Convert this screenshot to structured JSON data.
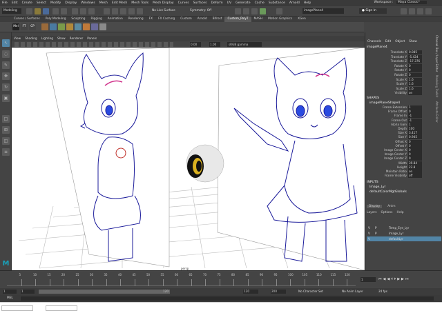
{
  "menubar": {
    "items": [
      "File",
      "Edit",
      "Create",
      "Select",
      "Modify",
      "Display",
      "Windows",
      "Mesh",
      "Edit Mesh",
      "Mesh Tools",
      "Mesh Display",
      "Curves",
      "Surfaces",
      "Deform",
      "UV",
      "Generate",
      "Cache",
      "Substance",
      "Arnold",
      "Help"
    ],
    "workspace": "Workspace :",
    "workspace_value": "Maya Classic*"
  },
  "status": {
    "mode": "Modeling",
    "live_surface": "No Live Surface",
    "symmetry": "Symmetry: Off",
    "search": "imagePlane4",
    "sign_in": "Sign In"
  },
  "shelf": {
    "tabs": [
      "Curves / Surfaces",
      "Poly Modeling",
      "Sculpting",
      "Rigging",
      "Animation",
      "Rendering",
      "FX",
      "FX Caching",
      "Custom",
      "Arnold",
      "Bifrost",
      "Custom_PolyT",
      "MASH",
      "Motion Graphics",
      "XGen"
    ],
    "active": "Custom_PolyT",
    "icons": [
      "Mel",
      "FT",
      "CP"
    ]
  },
  "panel": {
    "menus": [
      "View",
      "Shading",
      "Lighting",
      "Show",
      "Renderer",
      "Panels"
    ],
    "exposure": "0.00",
    "gamma": "1.00",
    "colorspace": "sRGB gamma",
    "camera": "persp"
  },
  "channelbox": {
    "menus": [
      "Channels",
      "Edit",
      "Object",
      "Show"
    ],
    "object": "imagePlane4",
    "transform": [
      [
        "Translate X",
        "0.085"
      ],
      [
        "Translate Y",
        "-5.424"
      ],
      [
        "Translate Z",
        "-17.376"
      ],
      [
        "Rotate X",
        "0"
      ],
      [
        "Rotate Y",
        "0"
      ],
      [
        "Rotate Z",
        "0"
      ],
      [
        "Scale X",
        "1.6"
      ],
      [
        "Scale Y",
        "1.6"
      ],
      [
        "Scale Z",
        "1.6"
      ],
      [
        "Visibility",
        "on"
      ]
    ],
    "shapes_label": "SHAPES",
    "shape_name": "imagePlaneShape4",
    "shape_attrs": [
      [
        "Frame Extension",
        "1"
      ],
      [
        "Frame Offset",
        "0"
      ],
      [
        "Frame In",
        "-1"
      ],
      [
        "Frame Out",
        "-1"
      ],
      [
        "Alpha Gain",
        "1"
      ],
      [
        "Depth",
        "100"
      ],
      [
        "Size X",
        "3.417"
      ],
      [
        "Size Y",
        "0.945"
      ],
      [
        "Offset X",
        "0"
      ],
      [
        "Offset Y",
        "0"
      ],
      [
        "Image Center X",
        "0"
      ],
      [
        "Image Center Y",
        "0"
      ],
      [
        "Image Center Z",
        "0"
      ],
      [
        "Width",
        "39.84"
      ],
      [
        "Height",
        "22.8"
      ],
      [
        "Maintain Ratio",
        "on"
      ],
      [
        "Frame Visibility",
        "off"
      ]
    ],
    "inputs_label": "INPUTS",
    "inputs": [
      "Image_Lyr",
      "defaultColorMgtGlobals"
    ]
  },
  "layers": {
    "tabs": [
      "Display",
      "Anim"
    ],
    "menus": [
      "Layers",
      "Options",
      "Help"
    ],
    "rows": [
      {
        "v": "V",
        "p": "P",
        "name": "Temp_Eye_Lyr",
        "sel": false
      },
      {
        "v": "V",
        "p": "P",
        "name": "Image_Lyr",
        "sel": false
      },
      {
        "v": "V",
        "p": "",
        "name": "defaultLyr",
        "sel": true
      }
    ]
  },
  "vtabs": [
    "Channel Box / Layer Editor",
    "Modeling Toolkit",
    "Attribute Editor"
  ],
  "timeline": {
    "ticks": [
      "5",
      "10",
      "15",
      "20",
      "25",
      "30",
      "35",
      "40",
      "45",
      "50",
      "55",
      "60",
      "65",
      "70",
      "75",
      "80",
      "85",
      "90",
      "95",
      "100",
      "105",
      "110",
      "115",
      "120"
    ],
    "current": "1"
  },
  "range": {
    "start": "1",
    "inner_start": "1",
    "inner_end": "120",
    "end": "120",
    "end2": "200",
    "char_set": "No Character Set",
    "anim_layer": "No Anim Layer",
    "fps": "24 fps"
  },
  "cmd": {
    "label": "MEL"
  }
}
